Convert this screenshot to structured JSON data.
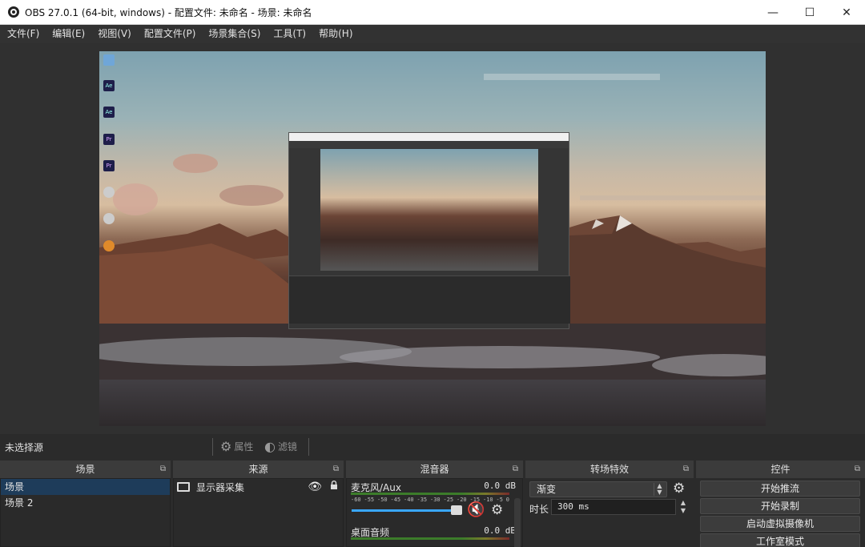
{
  "window": {
    "title": "OBS 27.0.1 (64-bit, windows) - 配置文件: 未命名 - 场景: 未命名",
    "min_glyph": "—",
    "max_glyph": "☐",
    "close_glyph": "✕"
  },
  "menu": [
    "文件(F)",
    "编辑(E)",
    "视图(V)",
    "配置文件(P)",
    "场景集合(S)",
    "工具(T)",
    "帮助(H)"
  ],
  "source_toolbar": {
    "no_selection": "未选择源",
    "properties_label": "属性",
    "filters_label": "滤镜"
  },
  "docks": {
    "scenes": {
      "title": "场景",
      "items": [
        {
          "label": "场景",
          "selected": true
        },
        {
          "label": "场景 2",
          "selected": false
        }
      ]
    },
    "sources": {
      "title": "来源",
      "items": [
        {
          "label": "显示器采集",
          "visible": true,
          "locked": true
        }
      ]
    },
    "mixer": {
      "title": "混音器",
      "channels": [
        {
          "name": "麦克风/Aux",
          "db": "0.0 dB",
          "muted": true
        },
        {
          "name": "桌面音频",
          "db": "0.0 dB",
          "muted": false
        }
      ],
      "ticks": [
        "-60",
        "-55",
        "-50",
        "-45",
        "-40",
        "-35",
        "-30",
        "-25",
        "-20",
        "-15",
        "-10",
        "-5",
        "0"
      ]
    },
    "transitions": {
      "title": "转场特效",
      "selected": "渐变",
      "duration_label": "时长",
      "duration_value": "300 ms"
    },
    "controls": {
      "title": "控件",
      "buttons": [
        "开始推流",
        "开始录制",
        "启动虚拟摄像机",
        "工作室模式"
      ]
    }
  },
  "icons": {
    "float": "float-icon",
    "gear": "gear-icon",
    "eye": "eye-icon",
    "lock": "lock-icon",
    "mute": "speaker-muted-icon"
  }
}
